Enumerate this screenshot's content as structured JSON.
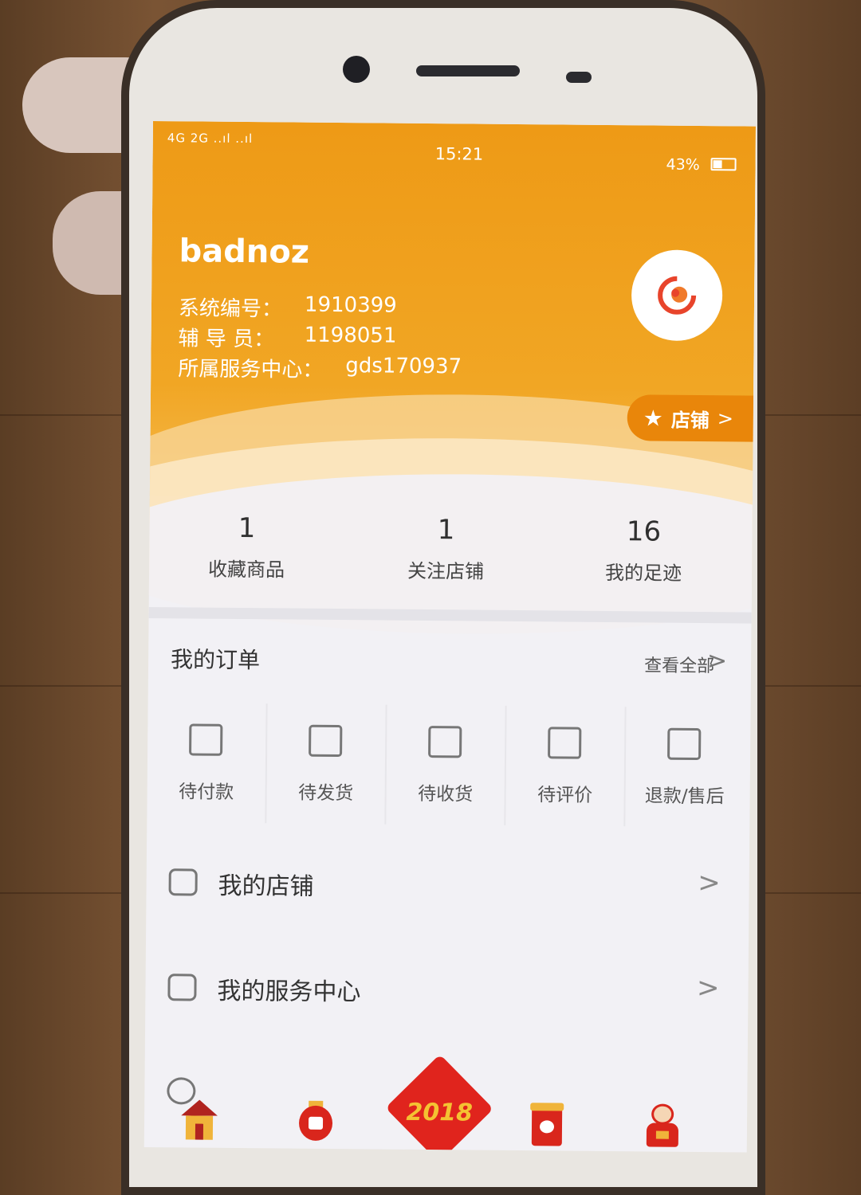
{
  "status_bar": {
    "signal": "4G 2G ..ıl ..ıl",
    "time": "15:21",
    "battery": "43%",
    "battery_level": 0.43
  },
  "profile": {
    "username": "badnoz",
    "fields": [
      {
        "label": "系统编号：",
        "value": "1910399"
      },
      {
        "label": "辅 导 员：",
        "value": "1198051"
      },
      {
        "label": "所属服务中心：",
        "value": "gds170937"
      }
    ],
    "shop_button": {
      "icon": "star-icon",
      "label": "店铺",
      "chevron": ">"
    }
  },
  "stats": [
    {
      "value": "1",
      "label": "收藏商品"
    },
    {
      "value": "1",
      "label": "关注店铺"
    },
    {
      "value": "16",
      "label": "我的足迹"
    }
  ],
  "orders": {
    "title": "我的订单",
    "view_all": "查看全部",
    "chevron": ">",
    "items": [
      {
        "label": "待付款",
        "icon": "wallet-icon"
      },
      {
        "label": "待发货",
        "icon": "box-icon"
      },
      {
        "label": "待收货",
        "icon": "truck-icon"
      },
      {
        "label": "待评价",
        "icon": "comment-icon"
      },
      {
        "label": "退款/售后",
        "icon": "refund-icon"
      }
    ]
  },
  "menu": [
    {
      "label": "我的店铺",
      "icon": "store-icon",
      "chevron": ">"
    },
    {
      "label": "我的服务中心",
      "icon": "heart-box-icon",
      "chevron": ">"
    },
    {
      "label": "",
      "icon": "partial-icon",
      "chevron": ""
    }
  ],
  "tabbar": {
    "center_label": "2018",
    "icons": [
      "house-icon",
      "lantern-icon",
      "new-year-2018-icon",
      "red-packet-icon",
      "caishen-icon"
    ]
  },
  "colors": {
    "header_orange": "#EE9A16",
    "accent_dark_orange": "#E9860A",
    "background": "#F2F1F5"
  }
}
